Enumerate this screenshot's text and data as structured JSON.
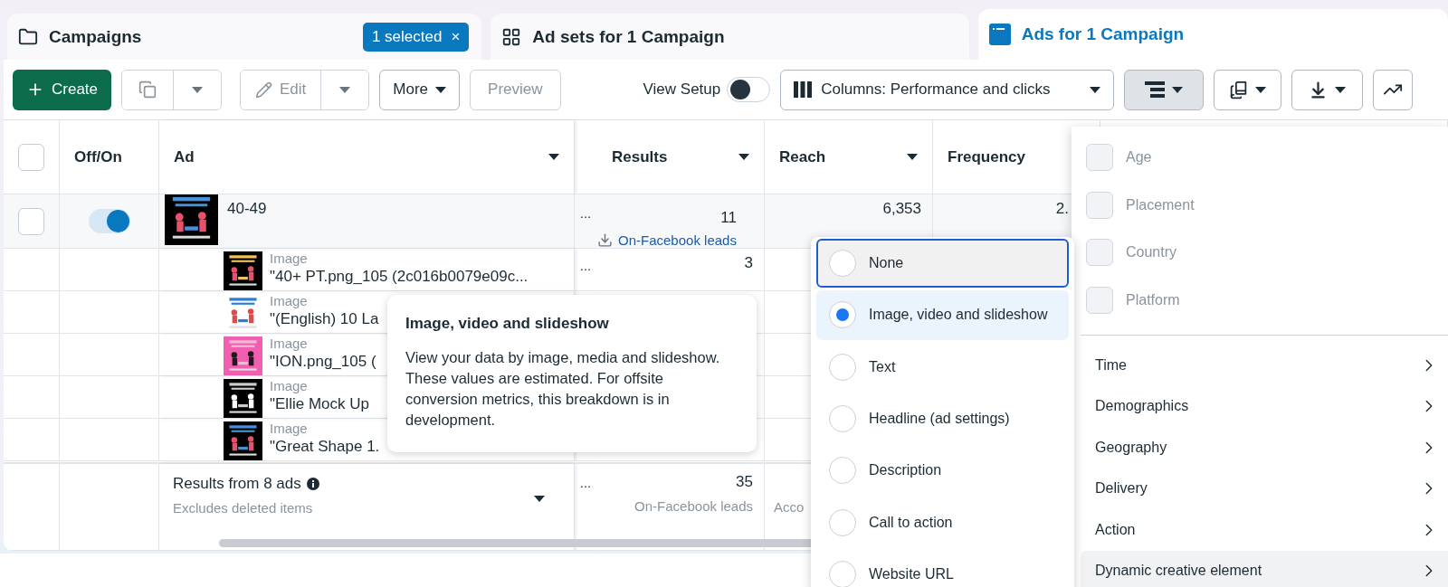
{
  "tabs": [
    {
      "label": "Campaigns",
      "badge": "1 selected",
      "badge_close": "×",
      "selected": false
    },
    {
      "label": "Ad sets for 1 Campaign",
      "selected": false
    },
    {
      "label": "Ads for 1 Campaign",
      "selected": true
    }
  ],
  "toolbar": {
    "create": "Create",
    "edit": "Edit",
    "more": "More",
    "preview": "Preview",
    "view_setup": {
      "label": "View Setup",
      "on": false
    },
    "columns": "Columns: Performance and clicks",
    "breakdown_open": true
  },
  "table": {
    "select_all_checked": false,
    "columns": [
      {
        "label": "Off/On",
        "sort": false
      },
      {
        "label": "Ad",
        "sort": true
      },
      {
        "label": "Results",
        "sort": true
      },
      {
        "label": "Reach",
        "sort": true
      },
      {
        "label": "Frequency",
        "sort": false
      }
    ],
    "row": {
      "checked": false,
      "on": true,
      "name": "40-49",
      "more": "...",
      "results": "11",
      "results_link": "On-Facebook leads",
      "reach": "6,353",
      "frequency": "2."
    },
    "sub_rows": [
      {
        "type": "Image",
        "name": "\"40+ PT.png_105 (2c016b0079e09c...",
        "more": "...",
        "results": "3"
      },
      {
        "type": "Image",
        "name": "\"(English) 10 La"
      },
      {
        "type": "Image",
        "name": "\"ION.png_105 ("
      },
      {
        "type": "Image",
        "name": "\"Ellie Mock Up"
      },
      {
        "type": "Image",
        "name": "\"Great Shape 1."
      }
    ],
    "footer": {
      "title": "Results from 8 ads",
      "note": "Excludes deleted items",
      "more": "...",
      "results": "35",
      "results_sub": "On-Facebook leads",
      "reach_sub": "Acco"
    }
  },
  "tooltip": {
    "title": "Image, video and slideshow",
    "body": "View your data by image, media and slideshow. These values are estimated. For offsite conversion metrics, this breakdown is in development."
  },
  "breakdown_options": [
    {
      "label": "None",
      "selected": false,
      "focused": true
    },
    {
      "label": "Image, video and slideshow",
      "selected": true,
      "focused": false
    },
    {
      "label": "Text",
      "selected": false,
      "focused": false
    },
    {
      "label": "Headline (ad settings)",
      "selected": false,
      "focused": false
    },
    {
      "label": "Description",
      "selected": false,
      "focused": false
    },
    {
      "label": "Call to action",
      "selected": false,
      "focused": false
    },
    {
      "label": "Website URL",
      "selected": false,
      "focused": false
    }
  ],
  "breakdown_menu": {
    "checkboxes": [
      {
        "label": "Age",
        "checked": false,
        "disabled": true
      },
      {
        "label": "Placement",
        "checked": false,
        "disabled": true
      },
      {
        "label": "Country",
        "checked": false,
        "disabled": true
      },
      {
        "label": "Platform",
        "checked": false,
        "disabled": true
      }
    ],
    "submenus": [
      {
        "label": "Time",
        "selected": false
      },
      {
        "label": "Demographics",
        "selected": false
      },
      {
        "label": "Geography",
        "selected": false
      },
      {
        "label": "Delivery",
        "selected": false
      },
      {
        "label": "Action",
        "selected": false
      },
      {
        "label": "Dynamic creative element",
        "selected": true
      }
    ]
  }
}
